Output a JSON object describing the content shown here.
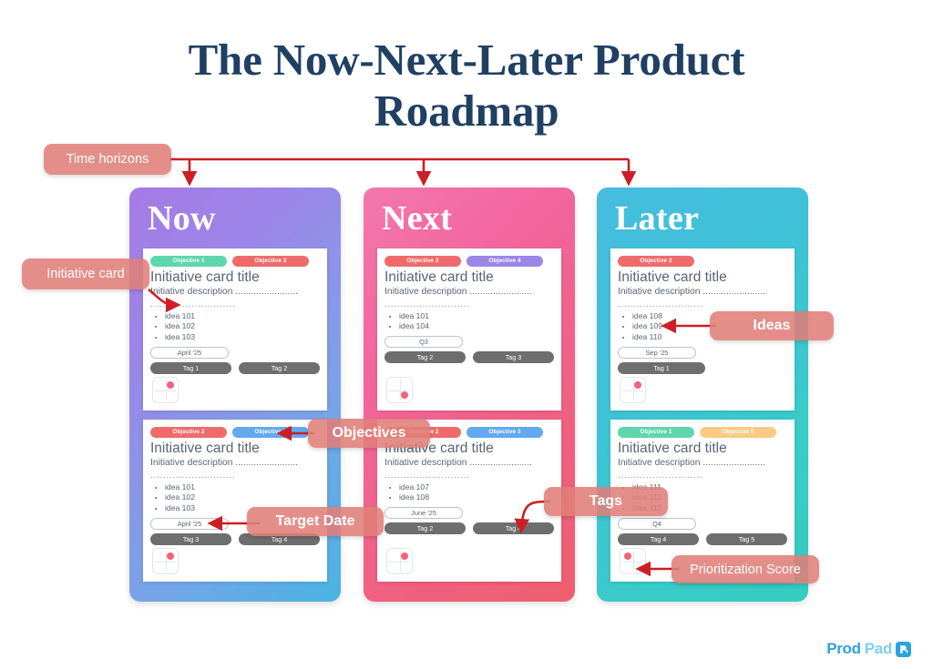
{
  "page": {
    "title": "The Now-Next-Later Product Roadmap",
    "title_line1": "The Now-Next-Later Product",
    "title_line2": "Roadmap",
    "title_color": "#1f4063",
    "background": "#ffffff"
  },
  "brand": {
    "name": "ProdPad",
    "name_part1": "Prod",
    "name_part2": "Pad",
    "color_primary": "#2ba3dd",
    "color_secondary": "#7fcdee"
  },
  "annotations": {
    "time_horizons": "Time horizons",
    "initiative_card": "Initiative card",
    "objectives": "Objectives",
    "ideas": "Ideas",
    "tags": "Tags",
    "target_date": "Target Date",
    "prioritization_score": "Prioritization Score",
    "callout_color": "#e07e79",
    "arrow_color": "#cc1f25"
  },
  "objective_colors": {
    "Objective 1": "#5fd6ae",
    "Objective 2": "#ef6b6b",
    "Objective 3": "#62a9ef",
    "Objective 4": "#9b86e8",
    "Objective 5": "#fcca83"
  },
  "columns": [
    {
      "id": "now",
      "label": "Now",
      "gradient_from": "#a67be5",
      "gradient_to": "#49b4e2",
      "cards": [
        {
          "objectives": [
            {
              "label": "Objective 1",
              "color_class": "obj-green"
            },
            {
              "label": "Objective 2",
              "color_class": "obj-red"
            }
          ],
          "title": "Initiative card title",
          "description": "Initiative description ........................",
          "description_line2": "...........................",
          "ideas": [
            "idea 101",
            "idea 102",
            "idea 103"
          ],
          "target_date": "April '25",
          "tags": [
            "Tag 1",
            "Tag 2"
          ],
          "prioritization_quadrant": "top-right"
        },
        {
          "objectives": [
            {
              "label": "Objective 2",
              "color_class": "obj-red"
            },
            {
              "label": "Objective 3",
              "color_class": "obj-blue"
            }
          ],
          "title": "Initiative card title",
          "description": "Initiative description ........................",
          "description_line2": "...........................",
          "ideas": [
            "idea 101",
            "idea 102",
            "idea 103"
          ],
          "target_date": "April '25",
          "tags": [
            "Tag 3",
            "Tag 4"
          ],
          "prioritization_quadrant": "top-right"
        }
      ]
    },
    {
      "id": "next",
      "label": "Next",
      "gradient_from": "#f378ac",
      "gradient_to": "#ef5f6e",
      "cards": [
        {
          "objectives": [
            {
              "label": "Objective 2",
              "color_class": "obj-red"
            },
            {
              "label": "Objective 4",
              "color_class": "obj-purple"
            }
          ],
          "title": "Initiative card title",
          "description": "Initiative description ........................",
          "description_line2": "...........................",
          "ideas": [
            "idea 101",
            "idea 104"
          ],
          "target_date": "Q3",
          "tags": [
            "Tag 2",
            "Tag 3"
          ],
          "prioritization_quadrant": "bottom-right"
        },
        {
          "objectives": [
            {
              "label": "Objective 2",
              "color_class": "obj-red"
            },
            {
              "label": "Objective 3",
              "color_class": "obj-blue"
            }
          ],
          "title": "Initiative card title",
          "description": "Initiative description ........................",
          "description_line2": "...........................",
          "ideas": [
            "idea 107",
            "idea 108"
          ],
          "target_date": "June '25",
          "tags": [
            "Tag 2",
            "Tag 4"
          ],
          "prioritization_quadrant": "top-right"
        }
      ]
    },
    {
      "id": "later",
      "label": "Later",
      "gradient_from": "#46bcdf",
      "gradient_to": "#34cdc0",
      "cards": [
        {
          "objectives": [
            {
              "label": "Objective 2",
              "color_class": "obj-red"
            }
          ],
          "title": "Initiative card title",
          "description": "Initiative description ........................",
          "description_line2": "...........................",
          "ideas": [
            "idea 108",
            "idea 109",
            "idea 110"
          ],
          "target_date": "Sep '25",
          "tags": [
            "Tag 1"
          ],
          "prioritization_quadrant": "top-right"
        },
        {
          "objectives": [
            {
              "label": "Objective 1",
              "color_class": "obj-green"
            },
            {
              "label": "Objective 5",
              "color_class": "obj-orange"
            }
          ],
          "title": "Initiative card title",
          "description": "Initiative description ........................",
          "description_line2": "...........................",
          "ideas": [
            "idea 111",
            "idea 112",
            "idea 113"
          ],
          "target_date": "Q4",
          "tags": [
            "Tag 4",
            "Tag 5"
          ],
          "prioritization_quadrant": "top-left"
        }
      ]
    }
  ]
}
